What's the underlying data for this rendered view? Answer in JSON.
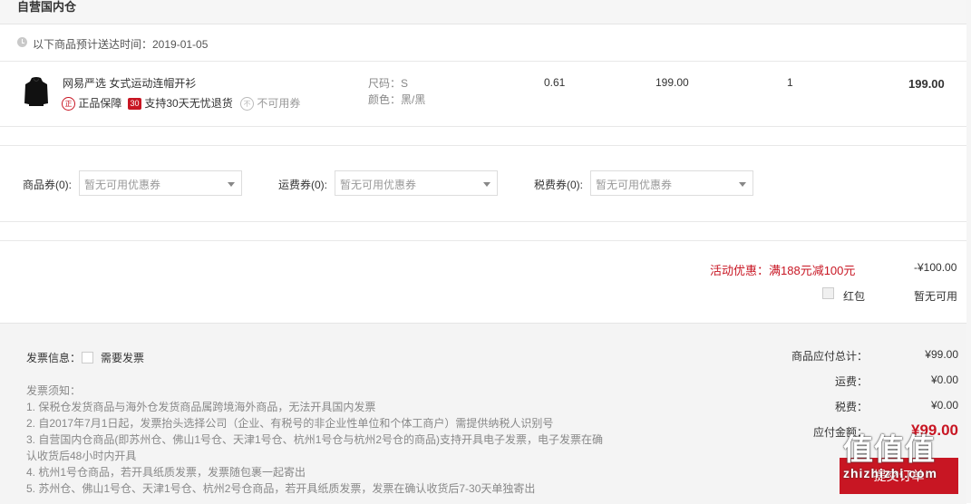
{
  "warehouse_title": "自营国内仓",
  "delivery_notice": "以下商品预计送达时间：2019-01-05",
  "product": {
    "name": "网易严选 女式运动连帽开衫",
    "tag_genuine_icon": "正",
    "tag_genuine": "正品保障",
    "tag_return_icon": "30",
    "tag_return": "支持30天无忧退货",
    "tag_coupon_icon": "不",
    "tag_coupon": "不可用券",
    "size": "尺码：S",
    "color": "颜色：黑/黑",
    "weight": "0.61",
    "price": "199.00",
    "quantity": "1",
    "subtotal": "199.00"
  },
  "coupons": {
    "goods_label": "商品券(0):",
    "goods_placeholder": "暂无可用优惠券",
    "shipping_label": "运费券(0):",
    "shipping_placeholder": "暂无可用优惠券",
    "tax_label": "税费券(0):",
    "tax_placeholder": "暂无可用优惠券"
  },
  "promotion": {
    "text": "活动优惠：满188元减100元",
    "amount": "-¥100.00",
    "red_packet_label": "红包",
    "red_packet_status": "暂无可用"
  },
  "invoice": {
    "label": "发票信息：",
    "checkbox_label": "需要发票",
    "notes_title": "发票须知：",
    "notes": [
      "1. 保税仓发货商品与海外仓发货商品属跨境海外商品，无法开具国内发票",
      "2. 自2017年7月1日起，发票抬头选择公司（企业、有税号的非企业性单位和个体工商户）需提供纳税人识别号",
      "3. 自营国内仓商品(即苏州仓、佛山1号仓、天津1号仓、杭州1号仓与杭州2号仓的商品)支持开具电子发票，电子发票在确",
      "认收货后48小时内开具",
      "4. 杭州1号仓商品，若开具纸质发票，发票随包裹一起寄出",
      "5. 苏州仓、佛山1号仓、天津1号仓、杭州2号仓商品，若开具纸质发票，发票在确认收货后7-30天单独寄出"
    ]
  },
  "summary": {
    "goods_total_label": "商品应付总计：",
    "goods_total": "¥99.00",
    "shipping_label": "运费：",
    "shipping": "¥0.00",
    "tax_label": "税费：",
    "tax": "¥0.00",
    "payable_label": "应付金额：",
    "payable": "¥99.00",
    "submit_label": "提交订单"
  },
  "watermark": {
    "glyphs": "值值值",
    "url": "zhizhizhi.com"
  },
  "colors": {
    "accent": "#c81623",
    "background_bottom": "#f4f4f4"
  }
}
